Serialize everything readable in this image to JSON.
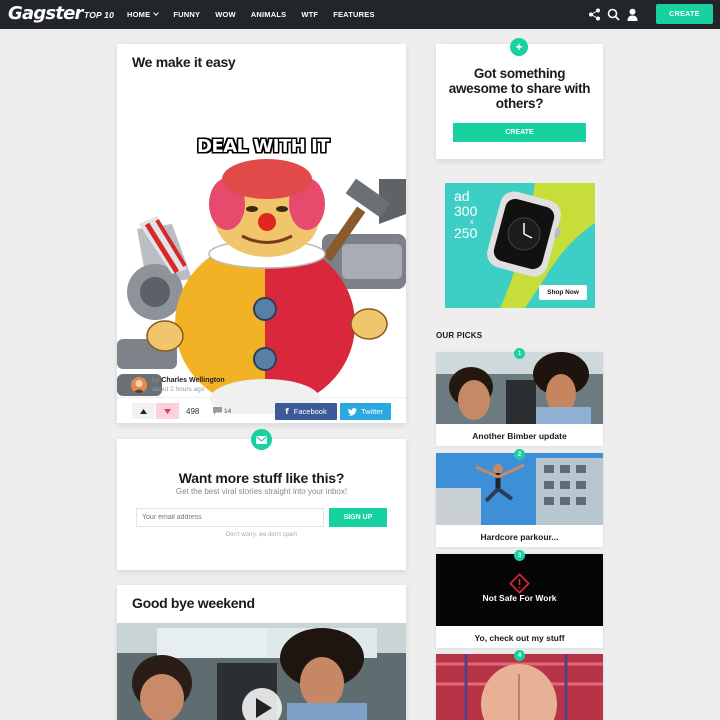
{
  "colors": {
    "accent": "#17d1a0",
    "topbar": "#22252a",
    "background": "#eeeeee",
    "facebook": "#3a5a98",
    "twitter": "#2aa9e0",
    "downvote": "#fbd1dc"
  },
  "header": {
    "logo": "Gagster",
    "nav": [
      "TOP 10",
      "HOME",
      "FUNNY",
      "WOW",
      "ANIMALS",
      "WTF",
      "FEATURES"
    ],
    "icons": [
      "share-icon",
      "search-icon",
      "user-icon"
    ],
    "create_label": "CREATE"
  },
  "post1": {
    "title": "We make it easy",
    "image_caption": "DEAL WITH IT",
    "author_prefix": "by",
    "author": "Charles Wellington",
    "time": "about 2 hours ago",
    "score": "498",
    "comments": "14",
    "facebook_label": "Facebook",
    "twitter_label": "Twitter"
  },
  "newsletter": {
    "title": "Want more stuff like this?",
    "subtitle": "Get the best viral stories straight into your inbox!",
    "placeholder": "Your email address",
    "button": "SIGN UP",
    "note": "Don't worry, we don't spam"
  },
  "post2": {
    "title": "Good bye weekend"
  },
  "cta": {
    "title": "Got something awesome to share with others?",
    "button": "CREATE"
  },
  "ad": {
    "line1": "ad",
    "line2": "300",
    "x": "x",
    "line3": "250",
    "button": "Shop Now"
  },
  "picks": {
    "heading": "OUR PICKS",
    "items": [
      {
        "num": "1",
        "label": "Another Bimber update"
      },
      {
        "num": "2",
        "label": "Hardcore parkour..."
      },
      {
        "num": "3",
        "label": "Yo, check out my stuff",
        "overlay": "Not Safe For Work"
      },
      {
        "num": "4",
        "label": ""
      }
    ]
  }
}
